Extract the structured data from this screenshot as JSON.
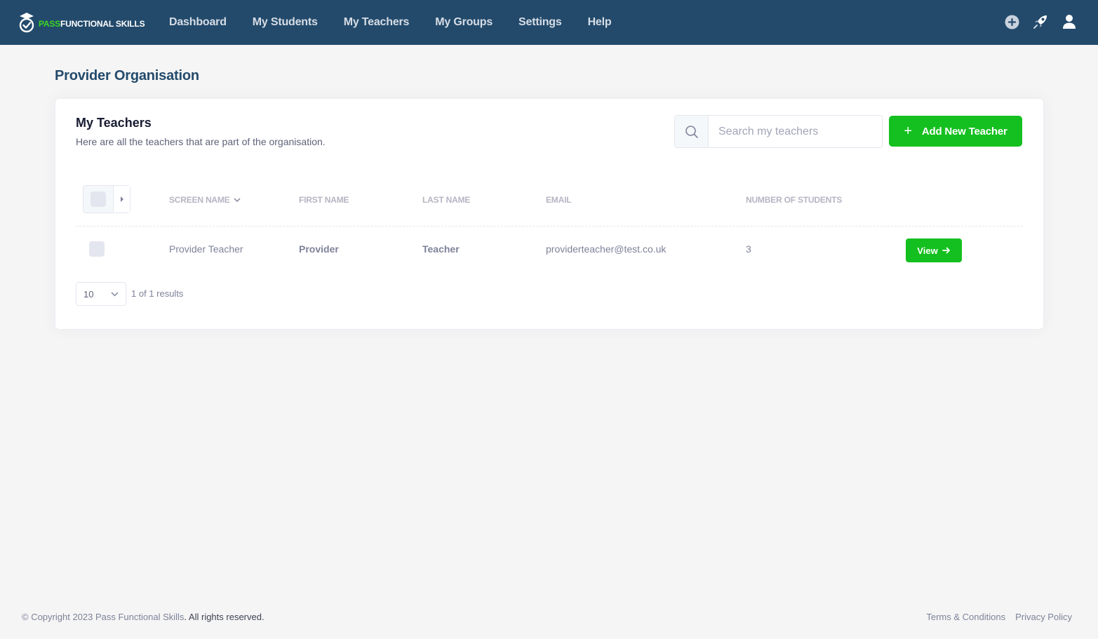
{
  "header": {
    "logo_pass": "PASS",
    "logo_rest": "FUNCTIONAL SKILLS",
    "nav": [
      {
        "label": "Dashboard"
      },
      {
        "label": "My Students"
      },
      {
        "label": "My Teachers"
      },
      {
        "label": "My Groups"
      },
      {
        "label": "Settings"
      },
      {
        "label": "Help"
      }
    ],
    "icons": [
      "plus-circle-icon",
      "rocket-icon",
      "user-icon"
    ]
  },
  "page": {
    "title": "Provider Organisation"
  },
  "card": {
    "title": "My Teachers",
    "subtitle": "Here are all the teachers that are part of the organisation.",
    "search_placeholder": "Search my teachers",
    "add_button_label": "Add New Teacher"
  },
  "table": {
    "columns": [
      "SCREEN NAME",
      "FIRST NAME",
      "LAST NAME",
      "EMAIL",
      "NUMBER OF STUDENTS"
    ],
    "rows": [
      {
        "screen_name": "Provider Teacher",
        "first_name": "Provider",
        "last_name": "Teacher",
        "email": "providerteacher@test.co.uk",
        "students": "3",
        "action": "View"
      }
    ]
  },
  "pagination": {
    "per_page": "10",
    "results": "1 of 1 results"
  },
  "footer": {
    "copyright_prefix": "© Copyright 2023 Pass Functional Skills",
    "copyright_suffix": ". All rights reserved.",
    "terms": "Terms & Conditions",
    "privacy": "Privacy Policy"
  },
  "colors": {
    "header_bg": "#234a6b",
    "brand_green": "#14c01f",
    "logo_green": "#3bd425",
    "page_bg": "#f5f5f5"
  }
}
